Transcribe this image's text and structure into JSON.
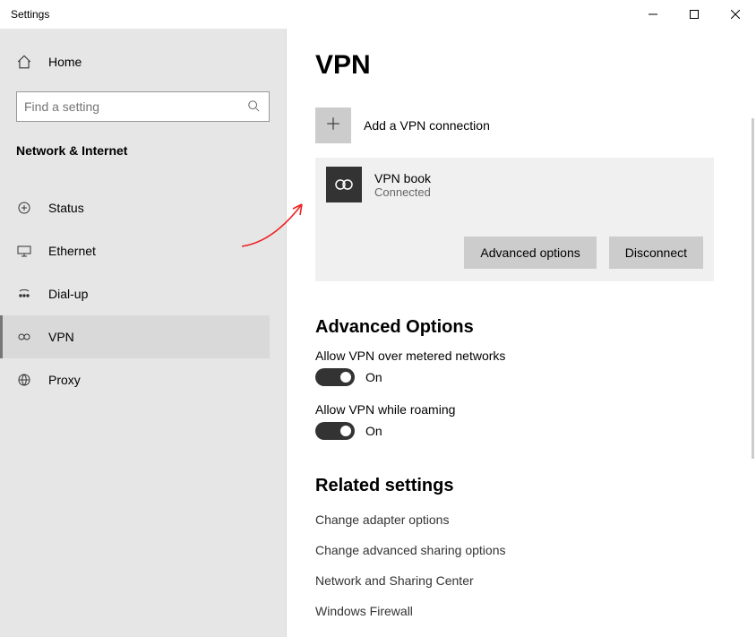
{
  "window": {
    "title": "Settings"
  },
  "sidebar": {
    "home_label": "Home",
    "search_placeholder": "Find a setting",
    "category": "Network & Internet",
    "items": [
      {
        "label": "Status"
      },
      {
        "label": "Ethernet"
      },
      {
        "label": "Dial-up"
      },
      {
        "label": "VPN"
      },
      {
        "label": "Proxy"
      }
    ]
  },
  "page": {
    "title": "VPN",
    "add_label": "Add a VPN connection",
    "connection": {
      "name": "VPN book",
      "status": "Connected",
      "advanced_button": "Advanced options",
      "disconnect_button": "Disconnect"
    },
    "advanced_options": {
      "heading": "Advanced Options",
      "metered_label": "Allow VPN over metered networks",
      "metered_state": "On",
      "roaming_label": "Allow VPN while roaming",
      "roaming_state": "On"
    },
    "related": {
      "heading": "Related settings",
      "links": [
        "Change adapter options",
        "Change advanced sharing options",
        "Network and Sharing Center",
        "Windows Firewall"
      ]
    }
  }
}
